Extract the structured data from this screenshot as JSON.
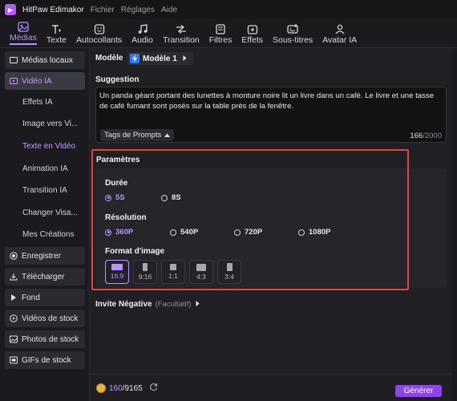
{
  "titlebar": {
    "app_name": "HitPaw Edimakor",
    "menu": [
      "Fichier",
      "Réglages",
      "Aide"
    ]
  },
  "toolbar": {
    "tabs": [
      {
        "label": "Médias",
        "icon": "media-icon",
        "active": true
      },
      {
        "label": "Texte",
        "icon": "text-icon"
      },
      {
        "label": "Autocollants",
        "icon": "sticker-icon"
      },
      {
        "label": "Audio",
        "icon": "music-icon"
      },
      {
        "label": "Transition",
        "icon": "transition-icon"
      },
      {
        "label": "Filtres",
        "icon": "filter-icon"
      },
      {
        "label": "Effets",
        "icon": "effects-icon"
      },
      {
        "label": "Sous-titres",
        "icon": "subtitles-icon"
      },
      {
        "label": "Avatar IA",
        "icon": "avatar-icon"
      }
    ]
  },
  "sidebar": {
    "medias_locaux": "Médias locaux",
    "video_ia": "Vidéo IA",
    "sub": [
      "Effets IA",
      "Image vers Vi...",
      "Texte en Vidéo",
      "Animation IA",
      "Transition IA",
      "Changer Visa...",
      "Mes Créations"
    ],
    "enregistrer": "Enregistrer",
    "telecharger": "Télécharger",
    "fond": "Fond",
    "videos_stock": "Vidéos de stock",
    "photos_stock": "Photos de stock",
    "gifs_stock": "GIFs de stock"
  },
  "main": {
    "model_label": "Modèle",
    "model_value": "Modèle 1",
    "suggestion_label": "Suggestion",
    "prompt_text": "Un panda géant portant des lunettes à monture noire lit un livre dans un café. Le livre et une tasse de café fumant sont posés sur la table près de la fenêtre.",
    "prompt_tags": "Tags de Prompts",
    "char_count": "166",
    "char_max": "/2000",
    "params_label": "Paramètres",
    "duree_label": "Durée",
    "durees": [
      {
        "label": "5S",
        "selected": true
      },
      {
        "label": "8S",
        "selected": false
      }
    ],
    "resolution_label": "Résolution",
    "resolutions": [
      {
        "label": "360P",
        "selected": true
      },
      {
        "label": "540P",
        "selected": false
      },
      {
        "label": "720P",
        "selected": false
      },
      {
        "label": "1080P",
        "selected": false
      }
    ],
    "format_label": "Format d'image",
    "formats": [
      {
        "label": "16:9",
        "selected": true
      },
      {
        "label": "9:16",
        "selected": false
      },
      {
        "label": "1:1",
        "selected": false
      },
      {
        "label": "4:3",
        "selected": false
      },
      {
        "label": "3:4",
        "selected": false
      }
    ],
    "negative_label": "Invite Négative",
    "negative_optional": "(Facultatif)"
  },
  "footer": {
    "credits_used": "160",
    "credits_total": "/9165",
    "generate_label": "Générer"
  },
  "colors": {
    "accent": "#b591ff",
    "highlight_border": "#e0463c",
    "generate": "#8e44e8"
  }
}
